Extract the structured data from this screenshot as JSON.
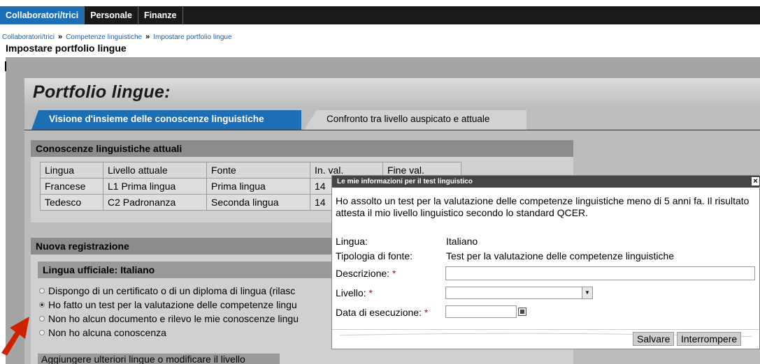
{
  "nav": {
    "tabs": [
      {
        "label": "Collaboratori/trici",
        "active": true
      },
      {
        "label": "Personale",
        "active": false
      },
      {
        "label": "Finanze",
        "active": false
      }
    ]
  },
  "breadcrumb": {
    "items": [
      "Collaboratori/trici",
      "Competenze linguistiche",
      "Impostare portfolio lingue"
    ],
    "separator": "»"
  },
  "page_title": "Impostare portfolio lingue",
  "portfolio": {
    "title": "Portfolio lingue:",
    "tabs": [
      {
        "label": "Visione d'insieme delle conoscenze linguistiche",
        "active": true
      },
      {
        "label": "Confronto tra livello auspicato e attuale",
        "active": false
      }
    ]
  },
  "current_skills": {
    "heading": "Conoscenze linguistiche attuali",
    "columns": [
      "Lingua",
      "Livello attuale",
      "Fonte",
      "In. val.",
      "Fine val."
    ],
    "rows": [
      [
        "Francese",
        "L1 Prima lingua",
        "Prima lingua",
        "14",
        ""
      ],
      [
        "Tedesco",
        "C2 Padronanza",
        "Seconda lingua",
        "14",
        ""
      ]
    ]
  },
  "new_entry": {
    "heading": "Nuova registrazione",
    "subheading": "Lingua ufficiale: Italiano",
    "options": [
      {
        "label": "Dispongo di un certificato o di un diploma di lingua (rilasc",
        "checked": false
      },
      {
        "label": "Ho fatto un test per la valutazione delle competenze lingu",
        "checked": true
      },
      {
        "label": "Non ho alcun documento e rilevo le mie conoscenze lingu",
        "checked": false
      },
      {
        "label": "Non ho alcuna conoscenza",
        "checked": false
      }
    ],
    "extra_button": "Aggiungere ulteriori lingue o modificare il livello"
  },
  "modal": {
    "title": "Le mie informazioni per il test linguistico",
    "close": "×",
    "description": "Ho assolto un test per la valutazione delle competenze linguistiche meno di 5 anni fa. Il risultato attesta il mio livello linguistico secondo lo standard QCER.",
    "language_label": "Lingua:",
    "language_value": "Italiano",
    "source_label": "Tipologia di fonte:",
    "source_value": "Test per la valutazione delle competenze linguistiche",
    "descr_label": "Descrizione:",
    "level_label": "Livello:",
    "date_label": "Data di esecuzione:",
    "required_mark": "*",
    "descr_value": "",
    "level_value": "",
    "date_value": "",
    "save": "Salvare",
    "cancel": "Interrompere"
  },
  "colors": {
    "accent": "#1c6fb4",
    "required": "#cc0000",
    "arrow": "#cc2200"
  }
}
